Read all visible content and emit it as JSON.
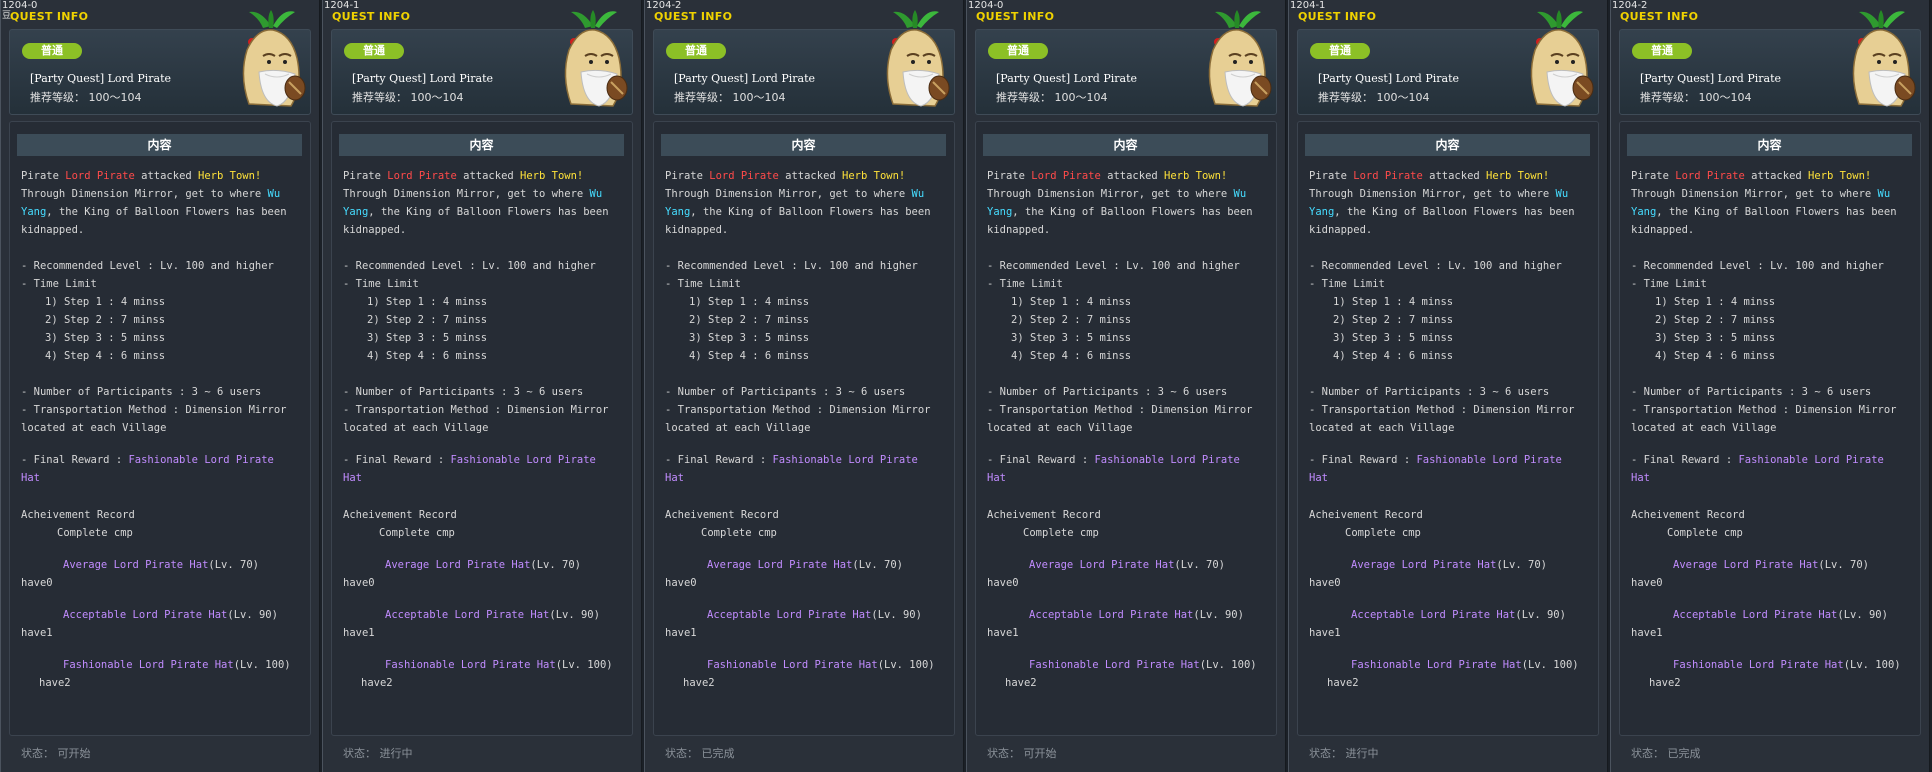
{
  "panels": [
    {
      "id": "1204-0",
      "status": "状态：  可开始"
    },
    {
      "id": "1204-1",
      "status": "状态：  进行中"
    },
    {
      "id": "1204-2",
      "status": "状态：  已完成"
    },
    {
      "id": "1204-0",
      "status": "状态：  可开始"
    },
    {
      "id": "1204-1",
      "status": "状态：  进行中"
    },
    {
      "id": "1204-2",
      "status": "状态：  已完成"
    }
  ],
  "first_panel_overlay": "豆",
  "quest": {
    "heading": "QUEST INFO",
    "grade": "普通",
    "title": "[Party Quest] Lord Pirate",
    "level": "推荐等级：  100～104",
    "content_header": "内容",
    "desc": {
      "l1a": "Pirate ",
      "l1b": "Lord Pirate",
      "l1c": " attacked ",
      "l1d": "Herb Town!",
      "l2a": "Through Dimension Mirror, get to where ",
      "l2b": "Wu",
      "l3a": "Yang",
      "l3b": ", the King of Balloon Flowers has been",
      "l4": "kidnapped."
    },
    "rec_level": "- Recommended Level  : Lv. 100 and higher",
    "time_limit": "- Time Limit",
    "steps": [
      "1) Step 1 : 4 minss",
      "2) Step 2 : 7 minss",
      "3) Step 3 : 5 minss",
      "4) Step 4 : 6 minss"
    ],
    "participants": "- Number of Participants  : 3 ~ 6 users",
    "transport_a": "- Transportation Method  : Dimension Mirror",
    "transport_b": "located at each Village",
    "reward_label": "- Final Reward  :  ",
    "reward_a": "Fashionable Lord Pirate",
    "reward_b": "Hat",
    "achievement": "Acheivement Record",
    "complete": "Complete    cmp",
    "hats": [
      {
        "name": "Average Lord Pirate Hat",
        "lv": "(Lv. 70)",
        "have": "have0"
      },
      {
        "name": "Acceptable Lord Pirate Hat",
        "lv": "(Lv. 90)",
        "have": "have1"
      },
      {
        "name": "Fashionable Lord Pirate Hat",
        "lv": "(Lv. 100)",
        "have": "have2"
      }
    ]
  },
  "colors": {
    "accent_yellow": "#f0d200",
    "badge_green": "#8cc026",
    "npc_red": "#ff4a4a",
    "npc_cyan": "#46dcff",
    "item_purple": "#c18cff"
  }
}
